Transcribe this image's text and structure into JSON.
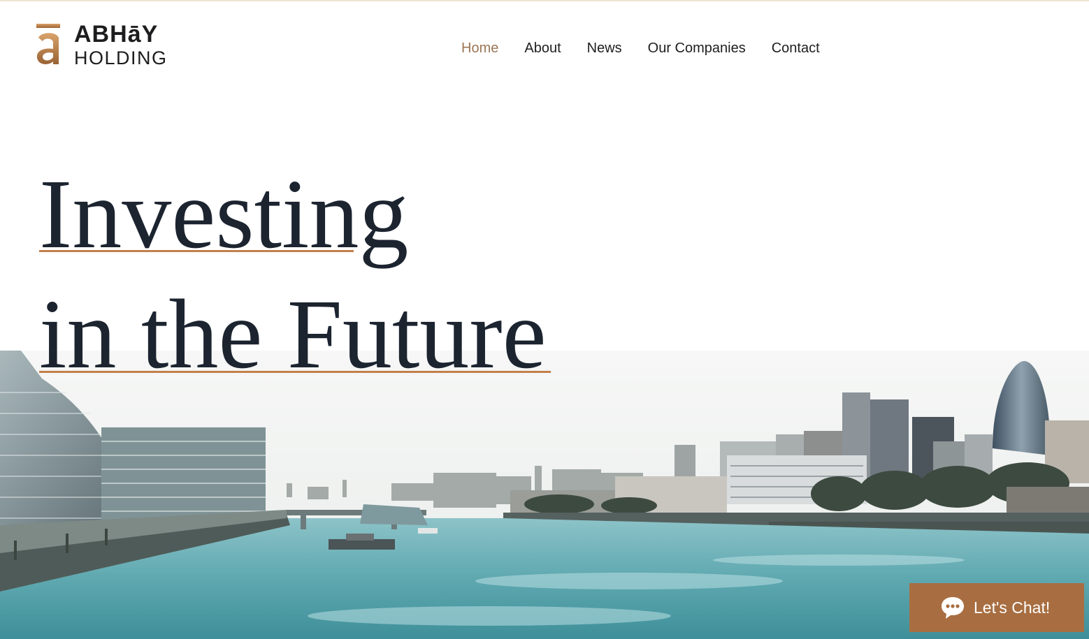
{
  "brand": {
    "name": "ABHāY",
    "subtitle": "HOLDING",
    "logo_icon": "letter-a-macron-logo",
    "accent_color": "#a86e41"
  },
  "nav": {
    "items": [
      {
        "label": "Home",
        "active": true
      },
      {
        "label": "About",
        "active": false
      },
      {
        "label": "News",
        "active": false
      },
      {
        "label": "Our Companies",
        "active": false
      },
      {
        "label": "Contact",
        "active": false
      }
    ],
    "active_color": "#9b7656"
  },
  "hero": {
    "headline_line1": "Investing",
    "headline_line2": "in the Future",
    "image_description_icon": "city-river-skyline-image"
  },
  "chat": {
    "label": "Let's Chat!",
    "icon": "chat-bubble-icon"
  }
}
